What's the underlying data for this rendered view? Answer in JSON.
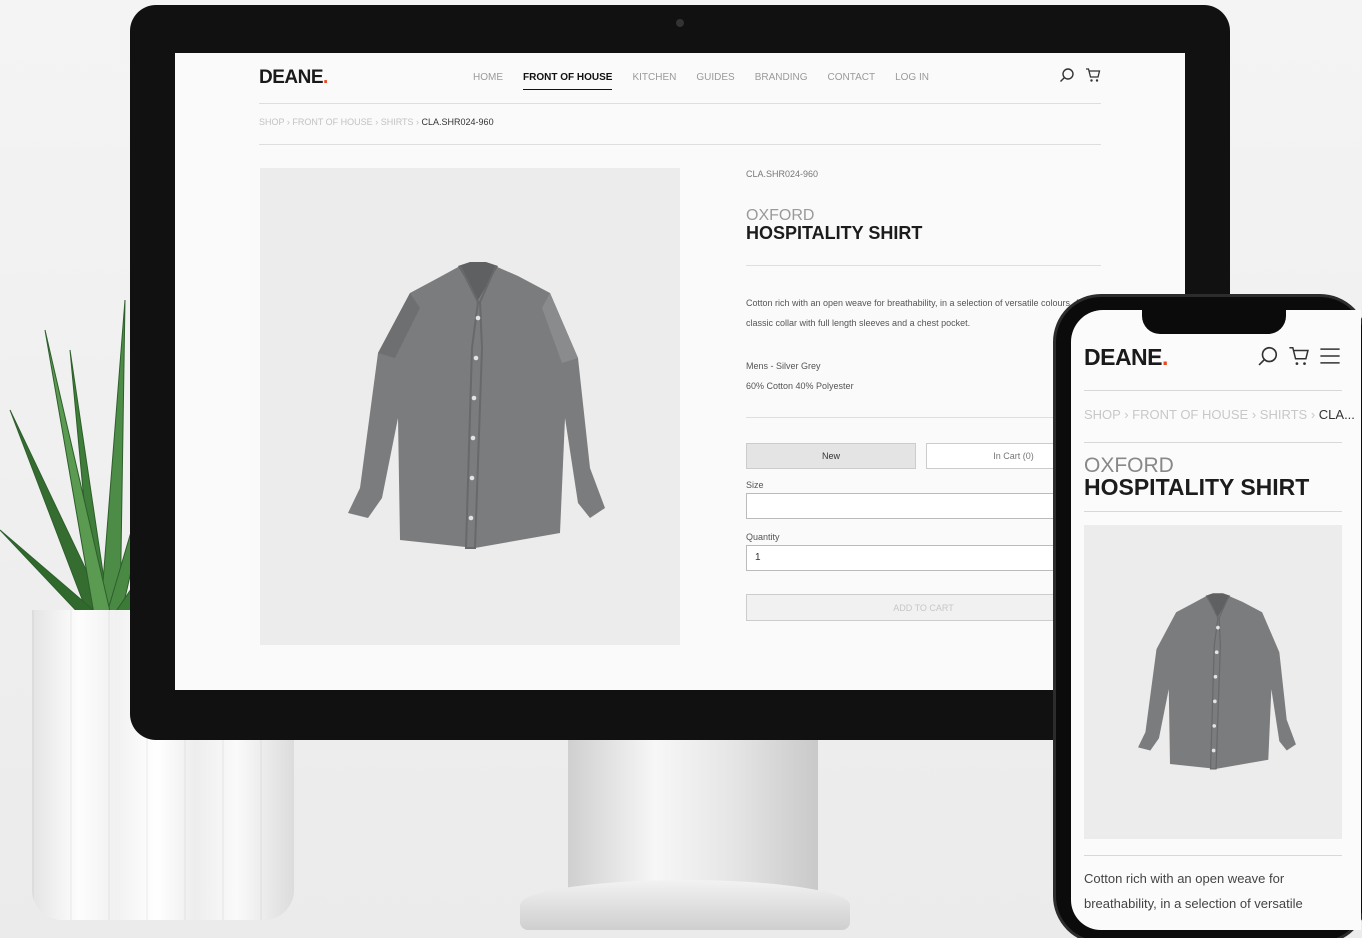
{
  "brand": {
    "name": "DEANE",
    "dot": ".",
    "accent_color": "#e8481d"
  },
  "nav": {
    "items": [
      "HOME",
      "FRONT OF HOUSE",
      "KITCHEN",
      "GUIDES",
      "BRANDING",
      "CONTACT",
      "LOG IN"
    ],
    "active": "FRONT OF HOUSE"
  },
  "icons": {
    "search": "search-icon",
    "cart": "cart-icon",
    "menu": "hamburger-icon"
  },
  "breadcrumb": {
    "parts": [
      "SHOP",
      "FRONT OF HOUSE",
      "SHIRTS"
    ],
    "separator": " › ",
    "current": "CLA.SHR024-960",
    "mobile_current": "CLA..."
  },
  "product": {
    "sku": "CLA.SHR024-960",
    "subtitle": "OXFORD",
    "title": "HOSPITALITY SHIRT",
    "description": "Cotton rich with an open weave for breathability, in a selection of versatile colours. A classic collar with full length sleeves and a chest pocket.",
    "mobile_description": "Cotton rich with an open weave for breathability, in a selection of versatile",
    "variant": "Mens - Silver Grey",
    "composition": "60% Cotton 40% Polyester"
  },
  "form": {
    "new_label": "New",
    "in_cart_label": "In Cart (0)",
    "size_label": "Size",
    "size_value": "",
    "quantity_label": "Quantity",
    "quantity_value": "1",
    "add_to_cart_label": "ADD TO CART"
  }
}
